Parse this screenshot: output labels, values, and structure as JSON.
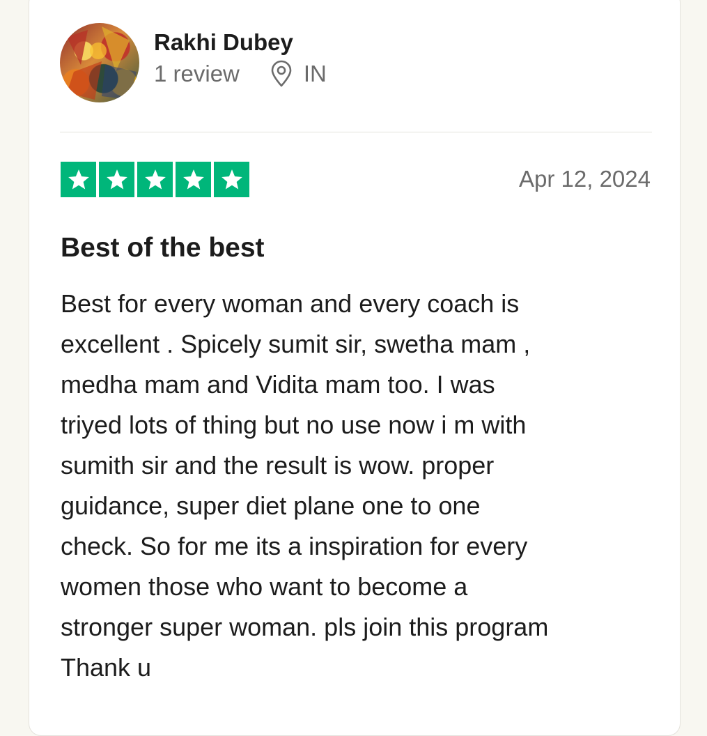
{
  "reviewer": {
    "name": "Rakhi Dubey",
    "review_count": "1 review",
    "country": "IN",
    "location_icon": "location-pin-icon"
  },
  "review": {
    "rating": 5,
    "rating_max": 5,
    "star_color": "#00b67a",
    "date": "Apr 12, 2024",
    "title": "Best of the best",
    "body_lines": [
      "Best for every woman and every coach is",
      "excellent . Spicely sumit sir, swetha mam ,",
      "medha mam and Vidita mam too. I was",
      "triyed lots of thing but no use now i m with",
      "sumith sir and the result is wow. proper",
      "guidance, super diet plane one to one",
      "check. So for me its a inspiration for every",
      "women those who want to become a",
      "stronger super woman. pls join this program",
      "Thank u"
    ]
  }
}
